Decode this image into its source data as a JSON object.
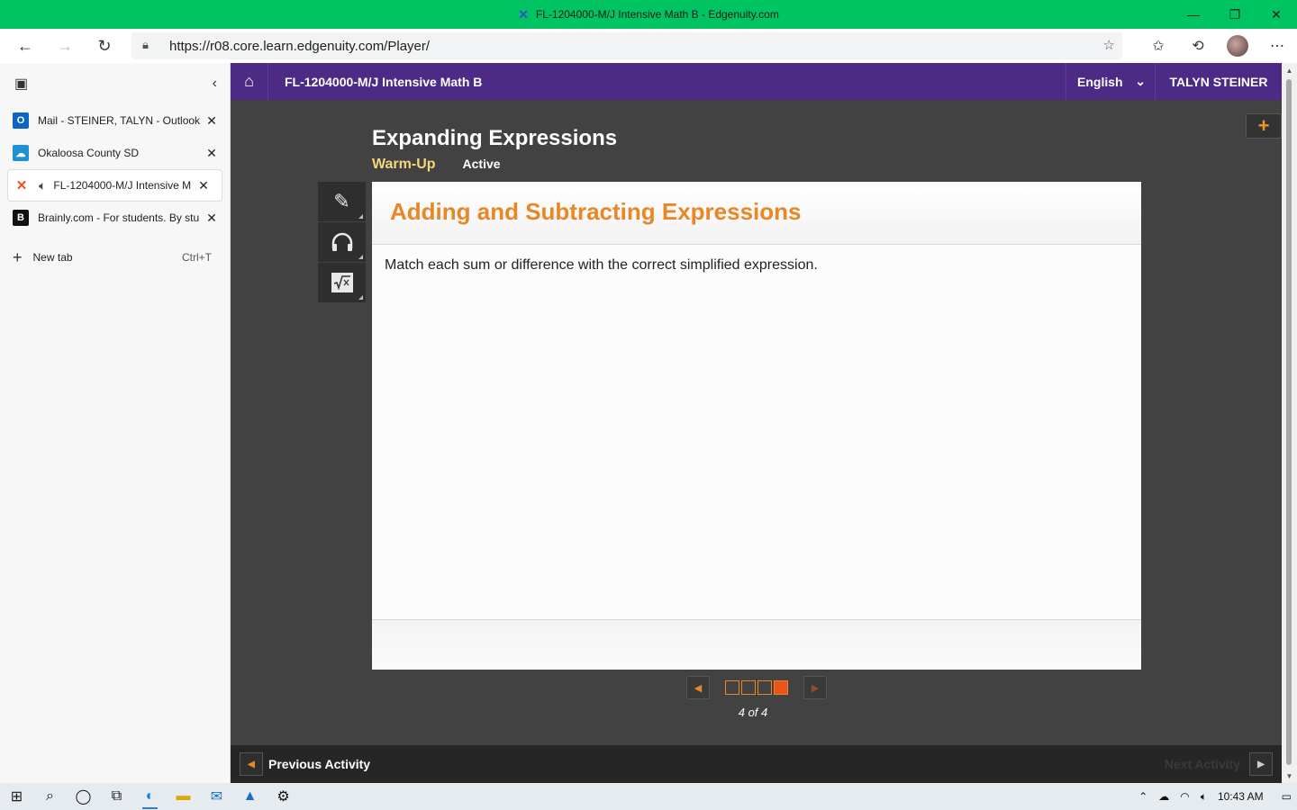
{
  "window": {
    "title": "FL-1204000-M/J Intensive Math B - Edgenuity.com",
    "minimize": "—",
    "restore": "❐",
    "close": "✕"
  },
  "browser": {
    "url": "https://r08.core.learn.edgenuity.com/Player/",
    "back": "←",
    "forward": "→",
    "refresh": "↻"
  },
  "sidebar": {
    "tabs": [
      {
        "label": "Mail - STEINER, TALYN - Outlook",
        "icon": "outlook-icon",
        "glyph": "O",
        "color": "#0a66c2"
      },
      {
        "label": "Okaloosa County SD",
        "icon": "cloud-icon",
        "glyph": "☁",
        "color": "#1e90d6"
      },
      {
        "label": "FL-1204000-M/J Intensive M",
        "icon": "edgenuity-icon",
        "glyph": "✕",
        "color": "#e8541a",
        "active": true
      },
      {
        "label": "Brainly.com - For students. By stu",
        "icon": "brainly-icon",
        "glyph": "B",
        "color": "#111111"
      }
    ],
    "new_tab": "New tab",
    "new_tab_shortcut": "Ctrl+T"
  },
  "app": {
    "course": "FL-1204000-M/J Intensive Math B",
    "language": "English",
    "user": "TALYN STEINER",
    "lesson_title": "Expanding Expressions",
    "activity": "Warm-Up",
    "status": "Active",
    "card_title": "Adding and Subtracting Expressions",
    "instruction": "Match each sum or difference with the correct simplified expression.",
    "pages": [
      false,
      false,
      false,
      true
    ],
    "page_count": "4 of 4",
    "prev_activity": "Previous Activity",
    "next_activity": "Next Activity"
  },
  "taskbar": {
    "time": "10:43 AM"
  }
}
